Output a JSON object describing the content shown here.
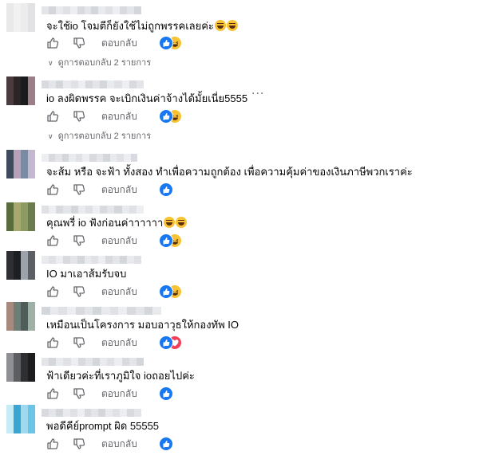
{
  "ui": {
    "reply_label": "ตอบกลับ",
    "more_label": "···"
  },
  "comments": [
    {
      "text": "จะใช้io โจมตีก็ยังใช้ไม่ถูกพรรคเลยค่ะ",
      "inline_emoji": [
        "grinning-squinting-face",
        "grinning-squinting-face"
      ],
      "reactions": [
        "like",
        "haha"
      ],
      "replies": "ดูการตอบกลับ 2 รายการ"
    },
    {
      "text": "io ลงผิดพรรค จะเบิกเงินค่าจ้างได้มั้ยเนี่ย5555",
      "inline_emoji": [],
      "reactions": [
        "like",
        "haha"
      ],
      "replies": "ดูการตอบกลับ 2 รายการ",
      "has_more": true
    },
    {
      "text": "จะส้ม หรือ จะฟ้า ทั้งสอง ทำเพื่อความถูกต้อง เพื่อความคุ้มค่าของเงินภาษีพวกเราค่ะ",
      "inline_emoji": [],
      "reactions": [
        "like"
      ],
      "replies": ""
    },
    {
      "text": "คุณพรี่ io ฟังก่อนค่าาาาาา",
      "inline_emoji": [
        "grinning-squinting-face",
        "grinning-squinting-face"
      ],
      "reactions": [
        "like",
        "haha"
      ],
      "replies": ""
    },
    {
      "text": "IO มาเอาส้มรับจบ",
      "inline_emoji": [],
      "reactions": [
        "like",
        "haha"
      ],
      "replies": ""
    },
    {
      "text": "เหมือนเป็นโครงการ มอบอาวุธให้กองทัพ IO",
      "inline_emoji": [],
      "reactions": [
        "like",
        "love"
      ],
      "replies": ""
    },
    {
      "text": "ฟ้าเดียวค่ะที่เราภูมิใจ ioถอยไปค่ะ",
      "inline_emoji": [],
      "reactions": [
        "like"
      ],
      "replies": ""
    },
    {
      "text": "พอดีคีย์prompt ผิด 55555",
      "inline_emoji": [],
      "reactions": [
        "like"
      ],
      "replies": ""
    }
  ],
  "colors": {
    "like": "#1877f2",
    "haha": "#f7c335",
    "love": "#f33e58",
    "secondary_text": "#65676b"
  }
}
